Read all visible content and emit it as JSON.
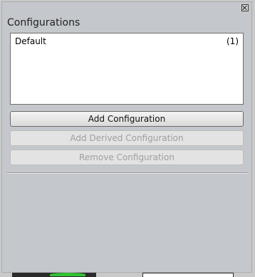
{
  "panel": {
    "title": "Configurations"
  },
  "configurations": [
    {
      "name": "Default",
      "count": "(1)"
    }
  ],
  "buttons": {
    "add": "Add Configuration",
    "add_derived": "Add Derived Configuration",
    "remove": "Remove Configuration"
  },
  "icons": {
    "close": "close-icon"
  },
  "colors": {
    "panel_bg": "#c4c7cb",
    "list_bg": "#ffffff",
    "disabled_text": "#9f9f9f"
  }
}
